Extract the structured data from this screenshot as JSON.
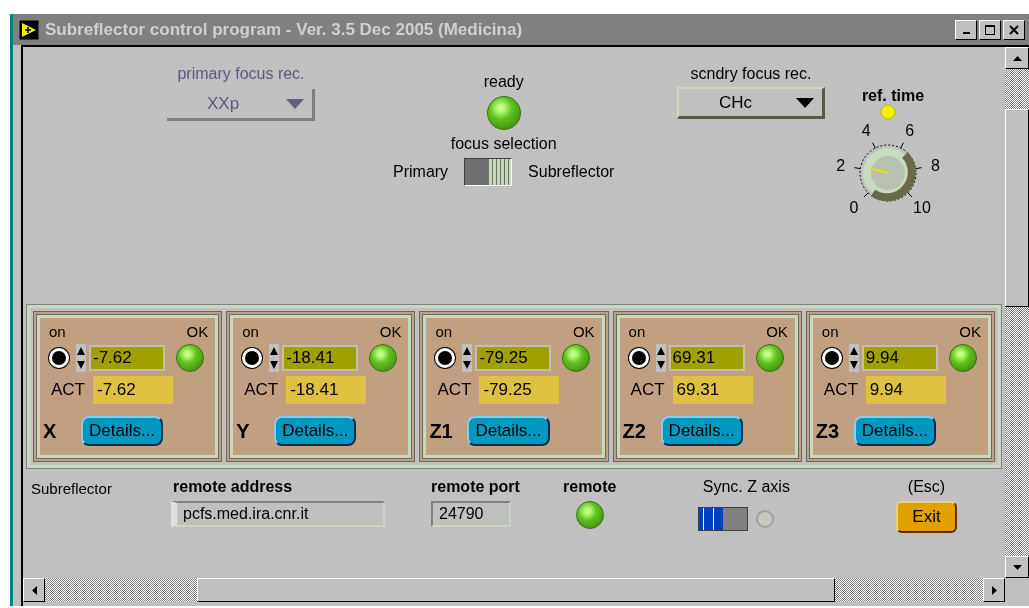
{
  "window": {
    "title": "Subreflector control program - Ver. 3.5 Dec 2005 (Medicina)"
  },
  "primary_focus": {
    "label": "primary focus rec.",
    "value": "XXp",
    "disabled": true
  },
  "ready": {
    "label": "ready",
    "on": true
  },
  "focus_selection": {
    "label": "focus selection",
    "left": "Primary",
    "right": "Subreflector",
    "on": true
  },
  "secondary_focus": {
    "label": "scndry focus rec.",
    "value": "CHc",
    "disabled": false
  },
  "ref_time": {
    "label": "ref. time",
    "indicator_on": true,
    "ticks": [
      "0",
      "2",
      "4",
      "6",
      "8",
      "10"
    ]
  },
  "axes": [
    {
      "name": "X",
      "on_label": "on",
      "ok_label": "OK",
      "selected": true,
      "setpoint": "-7.62",
      "ok": true,
      "act_label": "ACT",
      "actual": "-7.62",
      "button": "Details..."
    },
    {
      "name": "Y",
      "on_label": "on",
      "ok_label": "OK",
      "selected": true,
      "setpoint": "-18.41",
      "ok": true,
      "act_label": "ACT",
      "actual": "-18.41",
      "button": "Details..."
    },
    {
      "name": "Z1",
      "on_label": "on",
      "ok_label": "OK",
      "selected": true,
      "setpoint": "-79.25",
      "ok": true,
      "act_label": "ACT",
      "actual": "-79.25",
      "button": "Details..."
    },
    {
      "name": "Z2",
      "on_label": "on",
      "ok_label": "OK",
      "selected": true,
      "setpoint": "69.31",
      "ok": true,
      "act_label": "ACT",
      "actual": "69.31",
      "button": "Details..."
    },
    {
      "name": "Z3",
      "on_label": "on",
      "ok_label": "OK",
      "selected": true,
      "setpoint": "9.94",
      "ok": true,
      "act_label": "ACT",
      "actual": "9.94",
      "button": "Details..."
    }
  ],
  "bottom": {
    "caption": "Subreflector",
    "remote_address": {
      "label": "remote address",
      "value": "pcfs.med.ira.cnr.it"
    },
    "remote_port": {
      "label": "remote port",
      "value": "24790"
    },
    "remote": {
      "label": "remote",
      "on": true
    },
    "sync_z": {
      "label": "Sync. Z axis",
      "on": false
    },
    "exit": {
      "hint": "(Esc)",
      "label": "Exit"
    }
  }
}
